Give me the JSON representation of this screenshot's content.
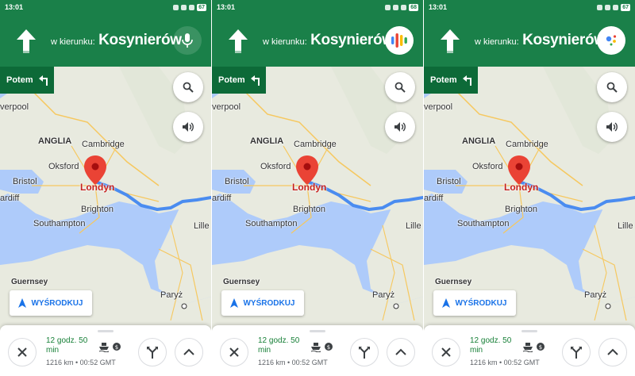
{
  "status": {
    "time": "13:01",
    "battery": [
      "67",
      "68",
      "67"
    ]
  },
  "navigation": {
    "prefix": "w kierunku:",
    "street": "Kosynierów",
    "then_label": "Potem"
  },
  "map": {
    "labels": {
      "liverpool": "verpool",
      "anglia": "ANGLIA",
      "cambridge": "Cambridge",
      "oksford": "Oksford",
      "bristol": "Bristol",
      "london": "Londyn",
      "cardiff": "ardiff",
      "brighton": "Brighton",
      "southampton": "Southampton",
      "lille": "Lille",
      "guernsey": "Guernsey",
      "paris": "Paryż"
    },
    "recenter_label": "WYŚRODKUJ"
  },
  "trip": {
    "eta": "12 godz. 50 min",
    "distance_time": "1216 km • 00:52 GMT"
  },
  "colors": {
    "nav_green": "#1a8049",
    "accent_blue": "#1a73e8",
    "eta_green": "#188038",
    "route": "#4a8cf0"
  },
  "icons": {
    "mic": "microphone-icon",
    "assistant_bars": "google-assistant-bars-icon",
    "assistant_dots": "google-assistant-dots-icon"
  }
}
